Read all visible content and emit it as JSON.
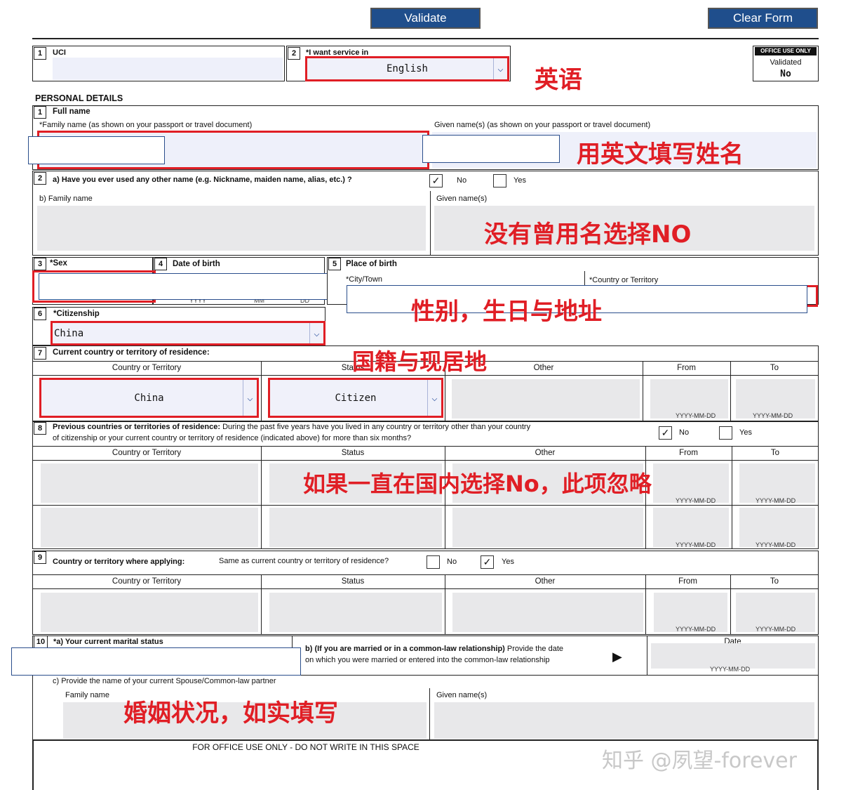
{
  "toolbar": {
    "validate": "Validate",
    "clear": "Clear Form"
  },
  "office": {
    "title": "OFFICE USE ONLY",
    "validated_label": "Validated",
    "validated_value": "No",
    "bottom": "FOR OFFICE USE ONLY - DO NOT WRITE IN THIS SPACE"
  },
  "header": {
    "uci_num": "1",
    "uci_label": "UCI",
    "svc_num": "2",
    "svc_label": "*I want service in",
    "svc_value": "English"
  },
  "section_title": "PERSONAL DETAILS",
  "q1": {
    "num": "1",
    "label": "Full name",
    "family_label": "*Family name (as shown on your passport or travel document)",
    "given_label": "Given name(s) (as shown on your passport or travel document)"
  },
  "q2": {
    "num": "2",
    "label": "a) Have you ever used any other name (e.g. Nickname, maiden name, alias, etc.) ?",
    "no": "No",
    "yes": "Yes",
    "family_label": "b) Family name",
    "given_label": "Given name(s)"
  },
  "q3": {
    "num": "3",
    "label": "*Sex"
  },
  "q4": {
    "num": "4",
    "label": "Date of birth",
    "yyyy": "YYYY",
    "mm": "MM",
    "dd": "DD"
  },
  "q5": {
    "num": "5",
    "label": "Place of birth",
    "city": "*City/Town",
    "country": "*Country or Territory"
  },
  "q6": {
    "num": "6",
    "label": "*Citizenship",
    "value": "China"
  },
  "q7": {
    "num": "7",
    "label": "Current country or territory of residence:",
    "country": "China",
    "status": "Citizen"
  },
  "cols": {
    "country": "Country or Territory",
    "status": "Status",
    "other": "Other",
    "from": "From",
    "to": "To",
    "date_fmt": "YYYY-MM-DD"
  },
  "q8": {
    "num": "8",
    "label_bold": "Previous countries or territories of residence:",
    "label_rest": " During the past five years have you lived in any country or territory other than your country",
    "label_line2": "of citizenship or your current country or territory of residence (indicated above) for more than six months?",
    "no": "No",
    "yes": "Yes"
  },
  "q9": {
    "num": "9",
    "label": "Country or territory  where applying:",
    "question": "Same as current country or territory of residence?",
    "no": "No",
    "yes": "Yes"
  },
  "q10": {
    "num": "10",
    "label": "*a) Your current marital status",
    "b_bold": "b) (If you are married or in a common-law relationship)",
    "b_rest": " Provide the date",
    "b_line2": "on which you were married or entered into the common-law relationship",
    "date": "Date",
    "c_label": "c) Provide the name of your current Spouse/Common-law partner",
    "family": "Family name",
    "given": "Given name(s)"
  },
  "annotations": {
    "english": "英语",
    "name": "用英文填写姓名",
    "no_alias": "没有曾用名选择NO",
    "sex_birth": "性别，生日与地址",
    "citizen": "国籍与现居地",
    "prev": "如果一直在国内选择No，此项忽略",
    "marital": "婚姻状况，如实填写"
  },
  "watermark": "知乎 @夙望-forever"
}
